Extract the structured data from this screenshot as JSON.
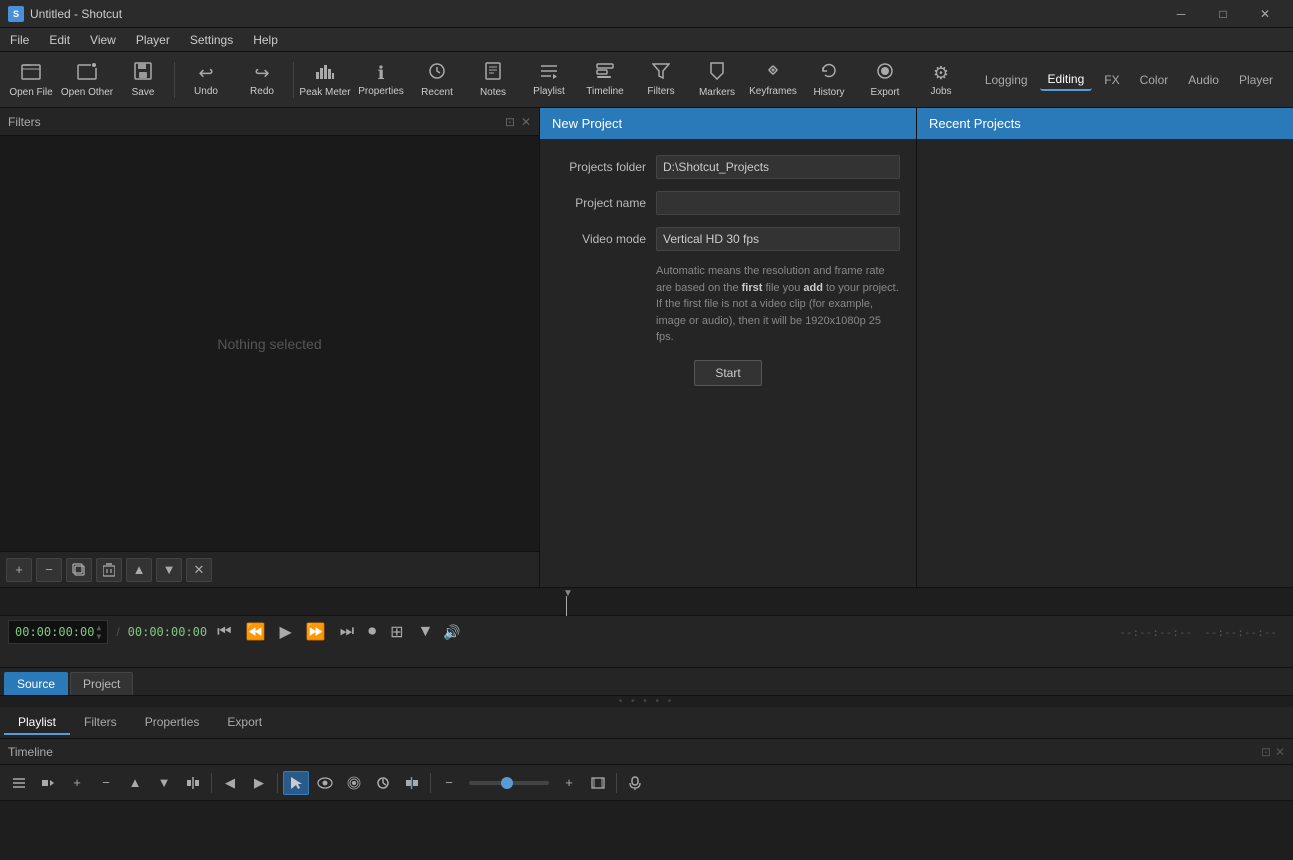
{
  "app": {
    "title": "Untitled - Shotcut",
    "icon": "S"
  },
  "titlebar": {
    "minimize": "─",
    "maximize": "□",
    "close": "✕"
  },
  "menu": {
    "items": [
      "File",
      "Edit",
      "View",
      "Player",
      "Settings",
      "Help"
    ]
  },
  "toolbar": {
    "buttons": [
      {
        "id": "open-file",
        "icon": "📂",
        "label": "Open File"
      },
      {
        "id": "open-other",
        "icon": "📋",
        "label": "Open Other"
      },
      {
        "id": "save",
        "icon": "💾",
        "label": "Save"
      },
      {
        "id": "undo",
        "icon": "↩",
        "label": "Undo"
      },
      {
        "id": "redo",
        "icon": "↪",
        "label": "Redo"
      },
      {
        "id": "peak-meter",
        "icon": "📊",
        "label": "Peak Meter"
      },
      {
        "id": "properties",
        "icon": "ℹ",
        "label": "Properties"
      },
      {
        "id": "recent",
        "icon": "🕐",
        "label": "Recent"
      },
      {
        "id": "notes",
        "icon": "📝",
        "label": "Notes"
      },
      {
        "id": "playlist",
        "icon": "☰",
        "label": "Playlist"
      },
      {
        "id": "timeline",
        "icon": "⏱",
        "label": "Timeline"
      },
      {
        "id": "filters",
        "icon": "⚗",
        "label": "Filters"
      },
      {
        "id": "markers",
        "icon": "🏷",
        "label": "Markers"
      },
      {
        "id": "keyframes",
        "icon": "🔑",
        "label": "Keyframes"
      },
      {
        "id": "history",
        "icon": "📜",
        "label": "History"
      },
      {
        "id": "export",
        "icon": "⬆",
        "label": "Export"
      },
      {
        "id": "jobs",
        "icon": "⚙",
        "label": "Jobs"
      }
    ],
    "layout_buttons": [
      "Logging",
      "Editing",
      "FX",
      "Color",
      "Audio",
      "Player"
    ],
    "active_layout": "Editing"
  },
  "filters_panel": {
    "title": "Filters",
    "close_icon": "✕",
    "resize_icon": "⊡",
    "preview_text": "Nothing selected",
    "controls": [
      "+",
      "−",
      "⧉",
      "🗑",
      "▲",
      "▼",
      "✕"
    ]
  },
  "new_project": {
    "header": "New Project",
    "fields": {
      "projects_folder_label": "Projects folder",
      "projects_folder_value": "D:\\Shotcut_Projects",
      "project_name_label": "Project name",
      "project_name_value": "",
      "video_mode_label": "Video mode",
      "video_mode_value": "Vertical HD 30 fps"
    },
    "description": "Automatic means the resolution and frame rate are based on the first file you add to your project. If the first file is not a video clip (for example, image or audio), then it will be 1920x1080p 25 fps.",
    "start_button": "Start"
  },
  "recent_projects": {
    "header": "Recent Projects"
  },
  "transport": {
    "timecode_current": "00:00:00:00",
    "timecode_total": "00:00:00:00",
    "scrub_pos": "▼"
  },
  "source_tabs": {
    "tabs": [
      "Source",
      "Project"
    ],
    "active": "Source",
    "drag_handle": "• • • • •"
  },
  "panel_tabs": {
    "tabs": [
      "Playlist",
      "Filters",
      "Properties",
      "Export"
    ],
    "active": "Playlist"
  },
  "timeline": {
    "title": "Timeline",
    "close_icon": "✕",
    "resize_icon": "⊡"
  }
}
